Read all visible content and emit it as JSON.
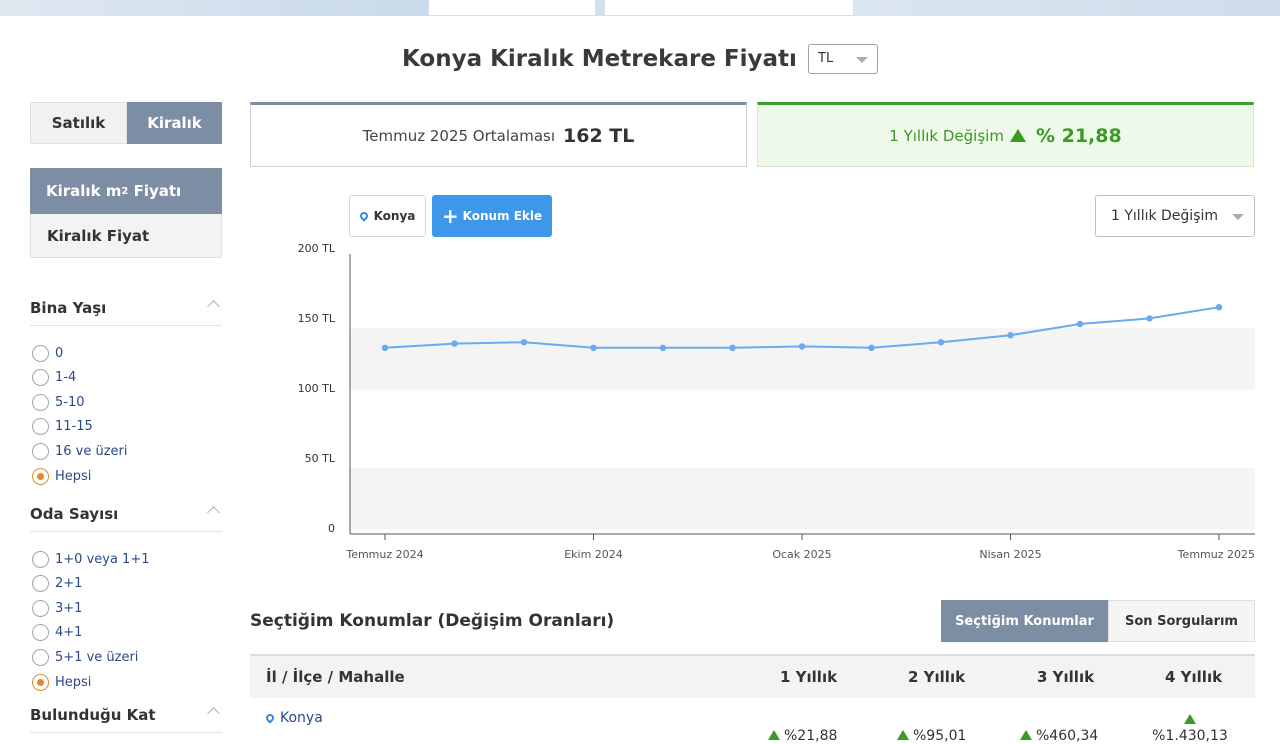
{
  "page": {
    "title": "Konya Kiralık Metrekare Fiyatı",
    "currency": "TL"
  },
  "sidebar": {
    "segment": [
      "Satılık",
      "Kiralık"
    ],
    "subnav": [
      "Kiralık m",
      "Kiralık Fiyat"
    ],
    "subnav_sup": "2",
    "subnav_suffix": " Fiyatı",
    "groups": [
      {
        "title": "Bina Yaşı",
        "options": [
          "0",
          "1-4",
          "5-10",
          "11-15",
          "16 ve üzeri",
          "Hepsi"
        ],
        "selected": 5
      },
      {
        "title": "Oda Sayısı",
        "options": [
          "1+0 veya 1+1",
          "2+1",
          "3+1",
          "4+1",
          "5+1 ve üzeri",
          "Hepsi"
        ],
        "selected": 5
      },
      {
        "title": "Bulunduğu Kat",
        "options": [],
        "selected": -1
      }
    ]
  },
  "stats": {
    "average_label": "Temmuz 2025 Ortalaması",
    "average_value": "162 TL",
    "change_label": "1 Yıllık Değişim",
    "change_value": "% 21,88"
  },
  "controls": {
    "location_chip": "Konya",
    "add_location": "Konum Ekle",
    "range_select": "1 Yıllık Değişim"
  },
  "chart_data": {
    "type": "line",
    "x": [
      "Temmuz 2024",
      "Ağustos 2024",
      "Eylül 2024",
      "Ekim 2024",
      "Kasım 2024",
      "Aralık 2024",
      "Ocak 2025",
      "Şubat 2025",
      "Mart 2025",
      "Nisan 2025",
      "Mayıs 2025",
      "Haziran 2025",
      "Temmuz 2025"
    ],
    "xticks": [
      "Temmuz 2024",
      "Ekim 2024",
      "Ocak 2025",
      "Nisan 2025",
      "Temmuz 2025"
    ],
    "yticks": [
      "0",
      "50 TL",
      "100 TL",
      "150 TL",
      "200 TL"
    ],
    "series": [
      {
        "values": [
          133,
          136,
          137,
          133,
          133,
          133,
          134,
          133,
          137,
          142,
          150,
          154,
          162
        ]
      }
    ],
    "ylim": [
      0,
      200
    ],
    "color": "#6aaaf0",
    "grid": "alternating bands"
  },
  "table": {
    "title": "Seçtiğim Konumlar (Değişim Oranları)",
    "tabs": [
      "Seçtiğim Konumlar",
      "Son Sorgularım"
    ],
    "columns": [
      "İl / İlçe / Mahalle",
      "1 Yıllık",
      "2 Yıllık",
      "3 Yıllık",
      "4 Yıllık"
    ],
    "rows": [
      {
        "location": "Konya",
        "values": [
          "%21,88",
          "%95,01",
          "%460,34",
          "%1.430,13"
        ]
      }
    ]
  }
}
